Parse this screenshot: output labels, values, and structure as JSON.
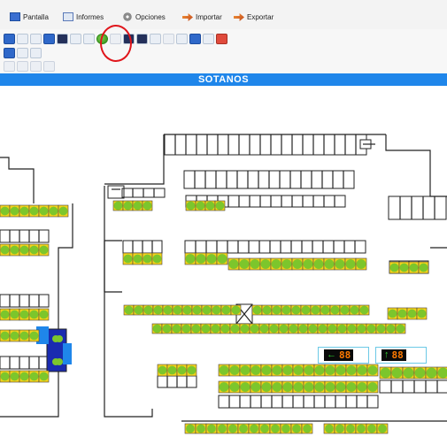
{
  "menu": {
    "items": [
      {
        "label": "Pantalla",
        "icon": "monitor-icon",
        "color": "#3a6fd1"
      },
      {
        "label": "Informes",
        "icon": "report-icon",
        "color": "#5a79b8"
      },
      {
        "label": "Opciones",
        "icon": "gear-icon",
        "color": "#8b8b8b"
      },
      {
        "label": "Importar",
        "icon": "import-icon",
        "color": "#e06b2a"
      },
      {
        "label": "Exportar",
        "icon": "export-icon",
        "color": "#e06b2a"
      }
    ]
  },
  "toolbar": {
    "row1": [
      "save-icon",
      "image-icon",
      "edit-icon",
      "layers-icon",
      "monitor-icon",
      "print-icon",
      "back-icon",
      "green-spot-icon",
      "minus-icon",
      "grid-icon",
      "display-icon",
      "undo-icon",
      "window-icon",
      "chart-icon",
      "tools-icon",
      "print-icon",
      "close-icon"
    ],
    "row2": [
      "map-icon",
      "settings-icon",
      "link-icon"
    ],
    "row3": [
      "align-left-icon",
      "align-center-icon",
      "align-right-icon",
      "align-grid-icon"
    ],
    "highlighted": "green-spot-icon"
  },
  "title_bar": {
    "label": "SOTANOS",
    "color": "#1f86ea"
  },
  "map": {
    "name": "parking-level-map",
    "free_color": "#7cc62c",
    "spot_color": "#f5d21a",
    "wall_color": "#222222",
    "lift_color": "#1a2bb0",
    "signs": [
      {
        "name": "availability-sign-left",
        "arrow": "←",
        "display": "88"
      },
      {
        "name": "availability-sign-right",
        "arrow": "↑",
        "display": "88"
      }
    ]
  }
}
